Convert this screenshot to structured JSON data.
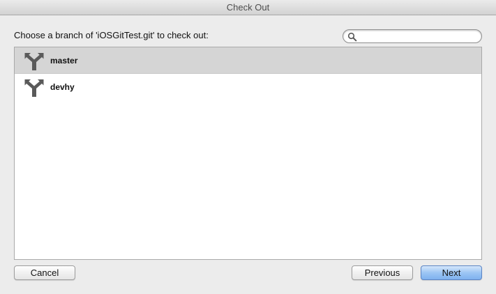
{
  "window": {
    "title": "Check Out"
  },
  "prompt": {
    "text": "Choose a branch of 'iOSGitTest.git' to check out:"
  },
  "search": {
    "value": "",
    "placeholder": "",
    "icon": "magnifying-glass-icon"
  },
  "branches": {
    "icon": "git-branch-icon",
    "items": [
      {
        "label": "master",
        "selected": true
      },
      {
        "label": "devhy",
        "selected": false
      }
    ]
  },
  "buttons": {
    "cancel_label": "Cancel",
    "previous_label": "Previous",
    "next_label": "Next"
  },
  "colors": {
    "selected_row": "#d5d5d5",
    "primary_button": "#9cc5f4",
    "branch_icon": "#5a5a5a"
  }
}
